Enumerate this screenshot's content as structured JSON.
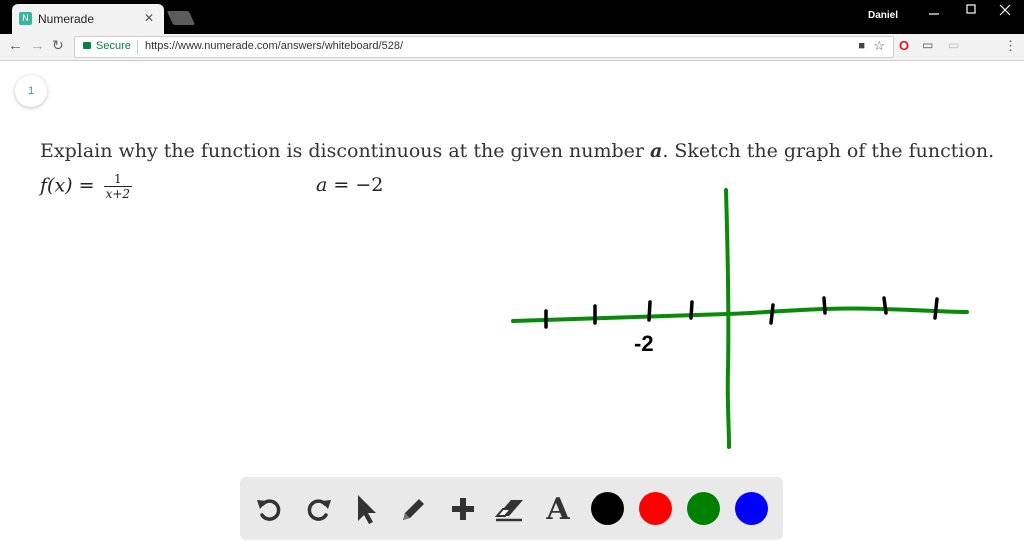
{
  "browser": {
    "tab_title": "Numerade",
    "favicon_letter": "N",
    "user": "Daniel",
    "security_label": "Secure",
    "url": "https://www.numerade.com/answers/whiteboard/528/"
  },
  "whiteboard": {
    "page_number": "1",
    "question_prefix": "Explain why the function is discontinuous at the given number ",
    "question_var": "a",
    "question_suffix": ". Sketch the graph of the function.",
    "function_lhs": "f(x) = ",
    "function_num": "1",
    "function_den": "x+2",
    "a_label": "a",
    "a_value": " = −2",
    "sketch_label": "-2"
  },
  "tools": {
    "items": [
      "undo-icon",
      "redo-icon",
      "pointer-icon",
      "pencil-icon",
      "plus-icon",
      "eraser-icon",
      "text-icon"
    ],
    "text_glyph": "A",
    "colors": [
      "#000000",
      "#ff0000",
      "#008000",
      "#0000ff"
    ]
  }
}
